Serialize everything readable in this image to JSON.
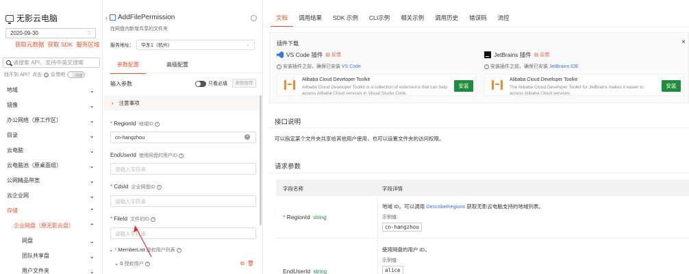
{
  "sidebar": {
    "brand": "无影云电脑",
    "date_value": "2020-09-30",
    "links": [
      "获取元数据",
      "获取 SDK",
      "服务区域"
    ],
    "search_placeholder": "请搜索 API，支持中英文搜索",
    "not_found_text": "找不到 API？点击",
    "feedback_text": "反馈吧",
    "toggle_text": "详细",
    "items": [
      {
        "label": "地域",
        "chev": "⌄",
        "state": "normal"
      },
      {
        "label": "镜像",
        "chev": "⌄",
        "state": "normal"
      },
      {
        "label": "办公网络（原工作区）",
        "chev": "⌄",
        "state": "normal"
      },
      {
        "label": "目录",
        "chev": "⌄",
        "state": "normal"
      },
      {
        "label": "云电脑",
        "chev": "⌄",
        "state": "normal"
      },
      {
        "label": "云电脑池（原桌面组）",
        "chev": "⌄",
        "state": "normal"
      },
      {
        "label": "公网精品带宽",
        "chev": "⌄",
        "state": "normal"
      },
      {
        "label": "云企业网",
        "chev": "⌄",
        "state": "normal"
      },
      {
        "label": "存储",
        "chev": "⌃",
        "state": "active"
      },
      {
        "label": "企业网盘（原无影云盘）",
        "chev": "⌃",
        "state": "sub"
      },
      {
        "label": "网盘",
        "chev": "⌄",
        "state": "sub2"
      },
      {
        "label": "团队共享盘",
        "chev": "⌄",
        "state": "sub2"
      },
      {
        "label": "用户文件夹",
        "chev": "⌄",
        "state": "sub2"
      }
    ]
  },
  "mid": {
    "api_name": "AddFilePermission",
    "api_desc": "在网盘内新增共享的文件夹",
    "server_label": "服务地址：",
    "server_value": "华东1（杭州）",
    "tabs": [
      "参数配置",
      "高级配置"
    ],
    "input_params": "输入参数",
    "required_only": "只看必填",
    "fill_params": "参数推荐",
    "notice": "注意事项",
    "fields": [
      {
        "name": "RegionId",
        "desc": "地域ID",
        "value": "cn-hangzhou",
        "required": "*",
        "placeholder": ""
      },
      {
        "name": "EndUserId",
        "desc": "使用网盘的用户ID",
        "value": "",
        "required": "",
        "placeholder": "请输入字符串"
      },
      {
        "name": "CdsId",
        "desc": "企业网盘ID",
        "value": "",
        "required": "*",
        "placeholder": "请输入字符串"
      },
      {
        "name": "FileId",
        "desc": "文件的ID",
        "value": "",
        "required": "*",
        "placeholder": "请输入字符串"
      }
    ],
    "member_list": "MemberList",
    "member_list_desc": "授权用户列表",
    "auth_user_index": "0",
    "auth_user": "授权用户"
  },
  "right": {
    "tabs": [
      "文档",
      "调用结果",
      "SDK 示例",
      "CLI示例",
      "相关示例",
      "调用历史",
      "错误码",
      "流控"
    ],
    "plugin_title": "插件下载",
    "vscode": {
      "name": "VS Code 插件",
      "feedback": "反馈",
      "hint": "安装插件之前，确保已安装",
      "hint_link": "VS Code",
      "card_title": "Alibaba Cloud Developer Toolkit",
      "card_desc": "Alibaba Cloud Developer Toolkit is a collection of extensions that can help access Alibaba Cloud services in Visual Studio Code.",
      "install": "安装"
    },
    "jetbrains": {
      "name": "JetBrains 插件",
      "feedback": "反馈",
      "hint": "安装插件之前，确保已安装",
      "hint_link": "JetBrains IDE",
      "card_title": "Alibaba Cloud Developer Toolkit",
      "card_desc": "The Alibaba Cloud Developer Toolkit for JetBrains makes it easier to access Alibaba Cloud services.",
      "install": "安装"
    },
    "api_desc_title": "接口说明",
    "api_desc_text": "可以指定某个文件夹共享给其他用户使用，也可以设置文件夹的访问权限。",
    "req_params_title": "请求参数",
    "col_name": "字段名称",
    "col_detail": "字段详情",
    "rows": [
      {
        "name": "RegionId",
        "type": "string",
        "required": "*",
        "desc_pre": "地域 ID。可以调用",
        "desc_link": "DescribeRegions",
        "desc_post": "获取无影云电脑支持的地域列表。",
        "ex_label": "示例值:",
        "ex_value": "cn-hangzhou"
      },
      {
        "name": "EndUserId",
        "type": "string",
        "required": "",
        "desc_pre": "使用网盘的用户 ID。",
        "desc_link": "",
        "desc_post": "",
        "ex_label": "示例值:",
        "ex_value": "alice"
      }
    ]
  }
}
